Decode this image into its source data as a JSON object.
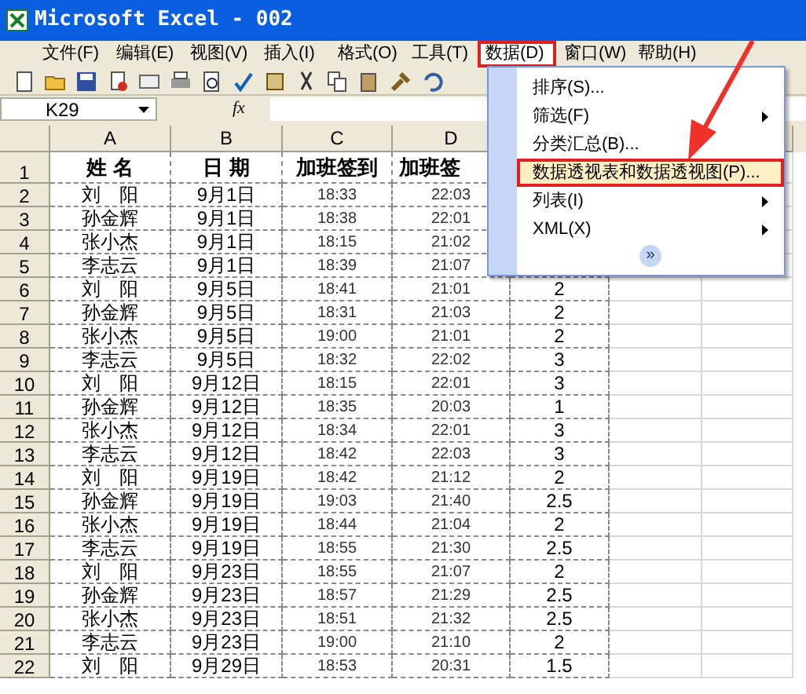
{
  "window": {
    "title": "Microsoft Excel - 002"
  },
  "menu_bar": [
    {
      "label": "文件(F)",
      "selected": false
    },
    {
      "label": "编辑(E)",
      "selected": false
    },
    {
      "label": "视图(V)",
      "selected": false
    },
    {
      "label": "插入(I)",
      "selected": false
    },
    {
      "label": "格式(O)",
      "selected": false
    },
    {
      "label": "工具(T)",
      "selected": false
    },
    {
      "label": "数据(D)",
      "selected": true
    },
    {
      "label": "窗口(W)",
      "selected": false
    },
    {
      "label": "帮助(H)",
      "selected": false
    }
  ],
  "formula_bar": {
    "name_box": "K29",
    "fx": "fx"
  },
  "dropdown_menu": {
    "items": [
      {
        "label": "排序(S)...",
        "kind": "command",
        "selected": false,
        "submenu": false
      },
      {
        "label": "筛选(F)",
        "kind": "command",
        "selected": false,
        "submenu": true
      },
      {
        "label": "分类汇总(B)...",
        "kind": "command",
        "selected": false,
        "submenu": false
      },
      {
        "label": "数据透视表和数据透视图(P)...",
        "kind": "command",
        "selected": true,
        "submenu": false
      },
      {
        "label": "列表(I)",
        "kind": "command",
        "selected": false,
        "submenu": true
      },
      {
        "label": "XML(X)",
        "kind": "command",
        "selected": false,
        "submenu": true
      },
      {
        "label": "»",
        "kind": "expand",
        "selected": false
      }
    ]
  },
  "sheet": {
    "columns": [
      "A",
      "B",
      "C",
      "D"
    ],
    "rows": [
      {
        "row": "1",
        "a": "姓 名",
        "b": "日 期",
        "c": "加班签到",
        "d": "加班签"
      },
      {
        "row": "2",
        "a": "刘　阳",
        "b": "9月1日",
        "c": "18:33",
        "d": "22:03"
      },
      {
        "row": "3",
        "a": "孙金辉",
        "b": "9月1日",
        "c": "18:38",
        "d": "22:01"
      },
      {
        "row": "4",
        "a": "张小杰",
        "b": "9月1日",
        "c": "18:15",
        "d": "21:02"
      },
      {
        "row": "5",
        "a": "李志云",
        "b": "9月1日",
        "c": "18:39",
        "d": "21:07"
      },
      {
        "row": "6",
        "a": "刘　阳",
        "b": "9月5日",
        "c": "18:41",
        "d": "21:01",
        "e": "2"
      },
      {
        "row": "7",
        "a": "孙金辉",
        "b": "9月5日",
        "c": "18:31",
        "d": "21:03",
        "e": "2"
      },
      {
        "row": "8",
        "a": "张小杰",
        "b": "9月5日",
        "c": "19:00",
        "d": "21:01",
        "e": "2"
      },
      {
        "row": "9",
        "a": "李志云",
        "b": "9月5日",
        "c": "18:32",
        "d": "22:02",
        "e": "3"
      },
      {
        "row": "10",
        "a": "刘　阳",
        "b": "9月12日",
        "c": "18:15",
        "d": "22:01",
        "e": "3"
      },
      {
        "row": "11",
        "a": "孙金辉",
        "b": "9月12日",
        "c": "18:35",
        "d": "20:03",
        "e": "1"
      },
      {
        "row": "12",
        "a": "张小杰",
        "b": "9月12日",
        "c": "18:34",
        "d": "22:01",
        "e": "3"
      },
      {
        "row": "13",
        "a": "李志云",
        "b": "9月12日",
        "c": "18:42",
        "d": "22:03",
        "e": "3"
      },
      {
        "row": "14",
        "a": "刘　阳",
        "b": "9月19日",
        "c": "18:42",
        "d": "21:12",
        "e": "2"
      },
      {
        "row": "15",
        "a": "孙金辉",
        "b": "9月19日",
        "c": "19:03",
        "d": "21:40",
        "e": "2.5"
      },
      {
        "row": "16",
        "a": "张小杰",
        "b": "9月19日",
        "c": "18:44",
        "d": "21:04",
        "e": "2"
      },
      {
        "row": "17",
        "a": "李志云",
        "b": "9月19日",
        "c": "18:55",
        "d": "21:30",
        "e": "2.5"
      },
      {
        "row": "18",
        "a": "刘　阳",
        "b": "9月23日",
        "c": "18:55",
        "d": "21:07",
        "e": "2"
      },
      {
        "row": "19",
        "a": "孙金辉",
        "b": "9月23日",
        "c": "18:57",
        "d": "21:29",
        "e": "2.5"
      },
      {
        "row": "20",
        "a": "张小杰",
        "b": "9月23日",
        "c": "18:51",
        "d": "21:32",
        "e": "2.5"
      },
      {
        "row": "21",
        "a": "李志云",
        "b": "9月23日",
        "c": "19:00",
        "d": "21:10",
        "e": "2"
      },
      {
        "row": "22",
        "a": "刘　阳",
        "b": "9月29日",
        "c": "18:53",
        "d": "20:31",
        "e": "1.5"
      }
    ]
  }
}
